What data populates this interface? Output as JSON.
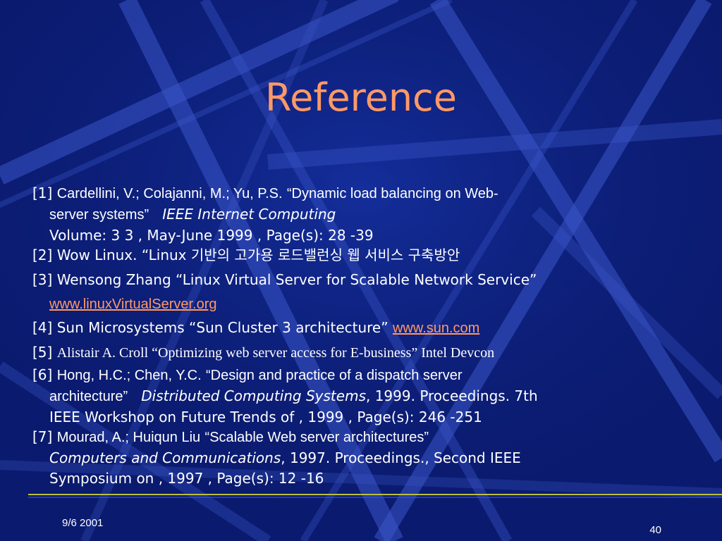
{
  "slide": {
    "title": "Reference",
    "colors": {
      "background": "#0a1a6e",
      "accent": "#ff9966",
      "text": "#ffffff",
      "footer_rule": "#b8c040"
    },
    "references": [
      {
        "num": "[1]",
        "authors": "Cardellini, V.; Colajanni, M.; Yu, P.S.",
        "title_line1": "“Dynamic load balancing on Web-",
        "title_line2": "server systems”",
        "journal": "IEEE Internet Computing",
        "details": "Volume: 3 3 , May-June 1999 , Page(s): 28 -39"
      },
      {
        "num": "[2]",
        "authors": "Wow Linux.",
        "title": "“Linux 기반의 고가용 로드밸런싱 웹 서비스 구축방안"
      },
      {
        "num": "[3]",
        "authors": "Wensong Zhang",
        "title": "“Linux Virtual Server for Scalable Network Service”",
        "link": "www.linuxVirtualServer.org"
      },
      {
        "num": "[4]",
        "authors": "Sun Microsystems",
        "title": "“Sun Cluster 3 architecture”",
        "link": "www.sun.com"
      },
      {
        "num": "[5]",
        "text": "Alistair A. Croll “Optimizing web server access for E-business” Intel Devcon"
      },
      {
        "num": "[6]",
        "authors": "Hong, H.C.; Chen, Y.C.",
        "title_line1": "“Design and practice of a dispatch server",
        "title_line2": "architecture”",
        "journal": "Distributed Computing Systems",
        "details_line1": ", 1999. Proceedings. 7th",
        "details_line2": "IEEE Workshop on Future Trends of , 1999 , Page(s): 246 -251"
      },
      {
        "num": "[7]",
        "authors": "Mourad, A.; Huiqun Liu",
        "title": "“Scalable Web server architectures”",
        "journal": "Computers and Communications",
        "details_line1": ", 1997. Proceedings., Second IEEE",
        "details_line2": "Symposium on , 1997 , Page(s): 12 -16"
      }
    ],
    "footer": {
      "date": "9/6 2001",
      "page_number": "40"
    }
  }
}
